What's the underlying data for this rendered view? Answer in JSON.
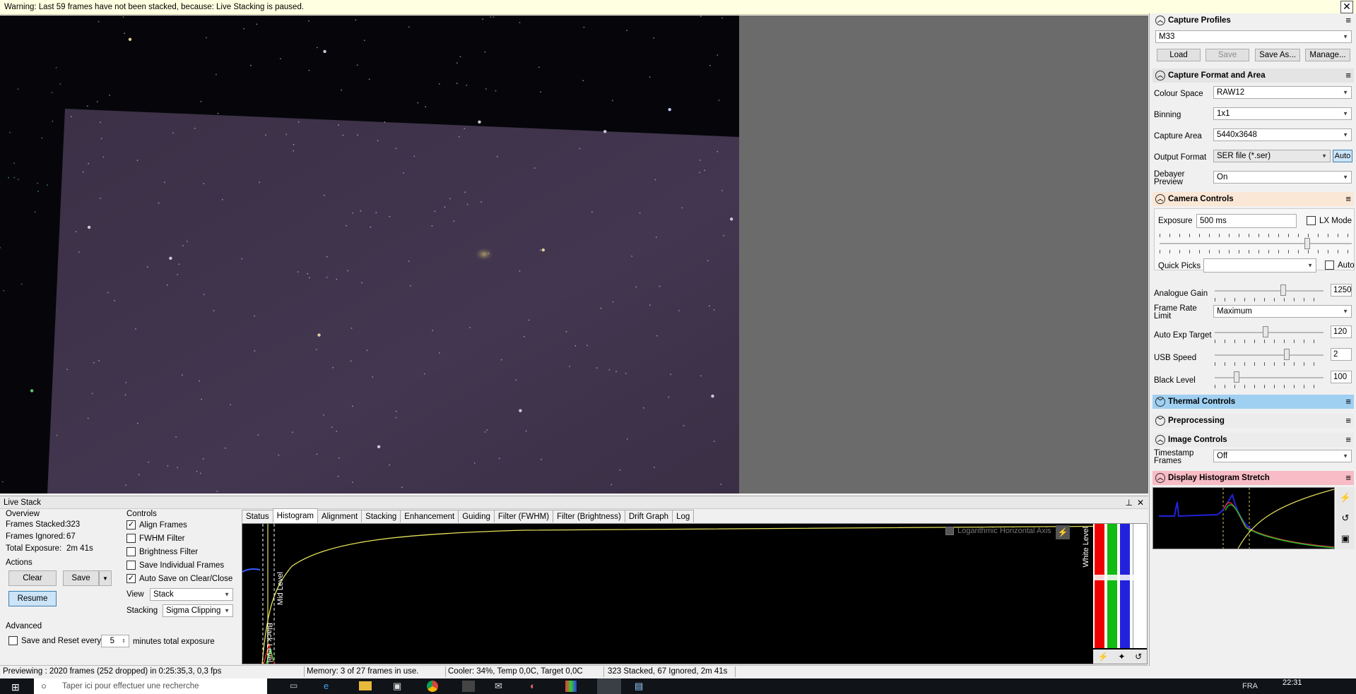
{
  "warning": {
    "text": "Warning: Last 59 frames have not been stacked, because: Live Stacking is paused.",
    "close": "✕"
  },
  "live_stack": {
    "title": "Live Stack",
    "overview": {
      "label": "Overview",
      "frames_stacked_label": "Frames Stacked:",
      "frames_stacked": "323",
      "frames_ignored_label": "Frames Ignored:",
      "frames_ignored": "67",
      "total_exposure_label": "Total Exposure:",
      "total_exposure": "2m 41s"
    },
    "actions": {
      "label": "Actions",
      "clear": "Clear",
      "save": "Save",
      "resume": "Resume"
    },
    "controls": {
      "label": "Controls",
      "align_frames": "Align Frames",
      "fwhm_filter": "FWHM Filter",
      "brightness_filter": "Brightness Filter",
      "save_individual": "Save Individual Frames",
      "auto_save": "Auto Save on Clear/Close",
      "view_label": "View",
      "view_value": "Stack",
      "stacking_label": "Stacking",
      "stacking_value": "Sigma Clipping"
    },
    "advanced": {
      "label": "Advanced",
      "save_reset": "Save and Reset every",
      "minutes_value": "5",
      "minutes_suffix": "minutes total exposure"
    },
    "tabs": [
      "Status",
      "Histogram",
      "Alignment",
      "Stacking",
      "Enhancement",
      "Guiding",
      "Filter (FWHM)",
      "Filter (Brightness)",
      "Drift Graph",
      "Log"
    ],
    "active_tab": "Histogram",
    "histogram": {
      "log_axis": "Logarithmic Horizontal Axis",
      "mid_level": "Mid Level",
      "black_level": "Black Level",
      "white_level": "White Level"
    }
  },
  "status_bar": {
    "previewing": "Previewing : 2020 frames (252 dropped) in 0:25:35,3, 0,3 fps",
    "memory": "Memory: 3 of 27 frames in use.",
    "cooler": "Cooler: 34%, Temp 0,0C, Target 0,0C",
    "stacked": "323 Stacked, 67 Ignored, 2m 41s"
  },
  "taskbar": {
    "search_placeholder": "Taper ici pour effectuer une recherche",
    "lang": "FRA",
    "time": "22:31"
  },
  "right_panel": {
    "capture_profiles": {
      "title": "Capture Profiles",
      "profile": "M33",
      "load": "Load",
      "save": "Save",
      "save_as": "Save As...",
      "manage": "Manage..."
    },
    "capture_format": {
      "title": "Capture Format and Area",
      "colour_space_label": "Colour Space",
      "colour_space": "RAW12",
      "binning_label": "Binning",
      "binning": "1x1",
      "capture_area_label": "Capture Area",
      "capture_area": "5440x3648",
      "output_format_label": "Output Format",
      "output_format": "SER file (*.ser)",
      "auto": "Auto",
      "debayer_label_1": "Debayer",
      "debayer_label_2": "Preview",
      "debayer": "On"
    },
    "camera_controls": {
      "title": "Camera Controls",
      "exposure_label": "Exposure",
      "exposure": "500 ms",
      "lx_mode": "LX Mode",
      "quick_picks_label": "Quick Picks",
      "quick_picks": "",
      "auto": "Auto",
      "analogue_gain_label": "Analogue Gain",
      "analogue_gain": "1250",
      "frame_rate_label_1": "Frame Rate",
      "frame_rate_label_2": "Limit",
      "frame_rate": "Maximum",
      "auto_exp_label": "Auto Exp Target",
      "auto_exp": "120",
      "usb_speed_label": "USB Speed",
      "usb_speed": "2",
      "black_level_label": "Black Level",
      "black_level": "100",
      "exposure_pos": 0.77,
      "gain_pos": 0.63,
      "auto_exp_pos": 0.47,
      "usb_pos": 0.66,
      "black_pos": 0.2
    },
    "thermal_controls": {
      "title": "Thermal Controls"
    },
    "preprocessing": {
      "title": "Preprocessing"
    },
    "image_controls": {
      "title": "Image Controls",
      "timestamp_label_1": "Timestamp",
      "timestamp_label_2": "Frames",
      "timestamp": "Off"
    },
    "display_histogram": {
      "title": "Display Histogram Stretch"
    }
  },
  "colors": {
    "thermal_header": "#9fd0f2",
    "camera_header": "#fbe7d6",
    "display_header": "#f7bcc5",
    "accent": "#0078d7"
  }
}
